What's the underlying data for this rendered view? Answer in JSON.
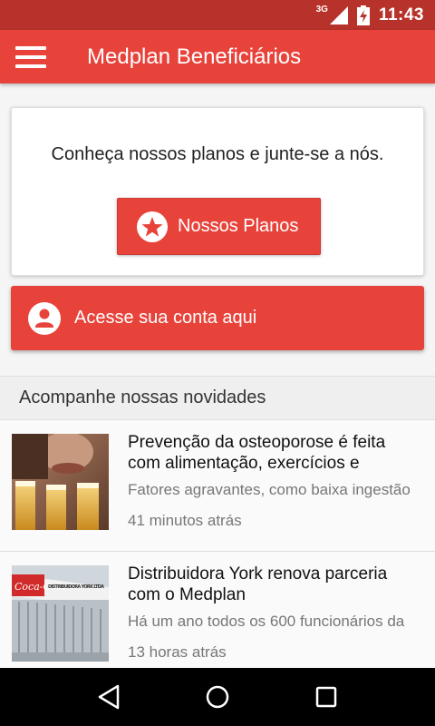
{
  "status_bar": {
    "network": "3G",
    "time": "11:43",
    "icons": [
      "signal-icon",
      "battery-charging-icon"
    ]
  },
  "app_bar": {
    "title": "Medplan Beneficiários",
    "menu_icon": "hamburger-menu-icon"
  },
  "colors": {
    "primary": "#e8433b",
    "status_bar": "#b7322a"
  },
  "plans_card": {
    "message": "Conheça nossos planos e junte-se a nós.",
    "button_label": "Nossos Planos",
    "button_icon": "star-icon"
  },
  "account_button": {
    "label": "Acesse sua conta aqui",
    "icon": "user-account-icon"
  },
  "news": {
    "section_title": "Acompanhe nossas novidades",
    "items": [
      {
        "headline": "Prevenção da osteoporose é feita com alimentação, exercícios e",
        "snippet": "Fatores agravantes, como baixa ingestão",
        "time": "41 minutos atrás",
        "image": "woman-with-beer-glasses-photo"
      },
      {
        "headline": "Distribuidora York renova parceria com o Medplan",
        "snippet": "Há um ano todos os 600 funcionários da",
        "time": "13 horas atrás",
        "image": "york-ltda-building-photo",
        "image_sign": "DISTRIBUIDORA YORK LTDA",
        "image_brand": "Coca-Cola"
      }
    ]
  },
  "nav_bar": {
    "buttons": [
      "back-icon",
      "home-icon",
      "recents-icon"
    ]
  }
}
